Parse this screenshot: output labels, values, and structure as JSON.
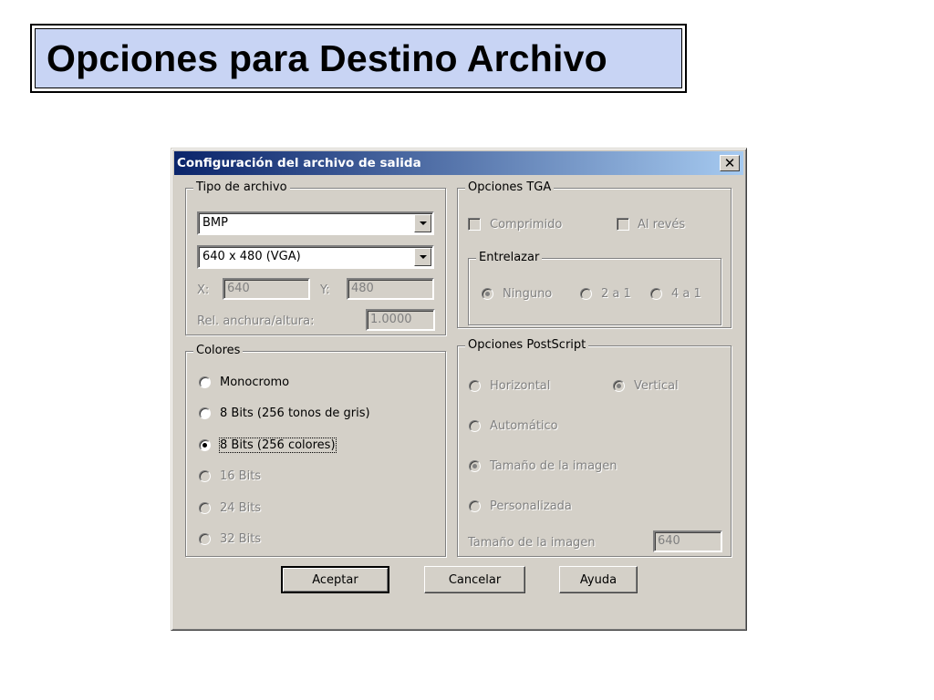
{
  "slide": {
    "title": "Opciones para Destino Archivo"
  },
  "dialog": {
    "title": "Configuración del archivo de salida",
    "close_label": "✕",
    "file_type": {
      "legend": "Tipo de archivo",
      "format_value": "BMP",
      "resolution_value": "640 x 480 (VGA)",
      "x_label": "X:",
      "x_value": "640",
      "y_label": "Y:",
      "y_value": "480",
      "ratio_label": "Rel. anchura/altura:",
      "ratio_value": "1.0000"
    },
    "colors": {
      "legend": "Colores",
      "options": [
        {
          "label": "Monocromo",
          "selected": false,
          "enabled": true
        },
        {
          "label": "8 Bits (256 tonos de gris)",
          "selected": false,
          "enabled": true
        },
        {
          "label": "8 Bits (256 colores)",
          "selected": true,
          "enabled": true
        },
        {
          "label": "16 Bits",
          "selected": false,
          "enabled": false
        },
        {
          "label": "24 Bits",
          "selected": false,
          "enabled": false
        },
        {
          "label": "32 Bits",
          "selected": false,
          "enabled": false
        }
      ]
    },
    "tga": {
      "legend": "Opciones TGA",
      "compressed_label": "Comprimido",
      "reversed_label": "Al revés",
      "interlace": {
        "legend": "Entrelazar",
        "none_label": "Ninguno",
        "two_label": "2 a 1",
        "four_label": "4 a 1",
        "selected": "Ninguno"
      }
    },
    "postscript": {
      "legend": "Opciones PostScript",
      "horizontal_label": "Horizontal",
      "vertical_label": "Vertical",
      "auto_label": "Automático",
      "image_size_option_label": "Tamaño de la imagen",
      "custom_label": "Personalizada",
      "image_size_label": "Tamaño de la imagen",
      "image_size_value": "640"
    },
    "buttons": {
      "accept": "Aceptar",
      "cancel": "Cancelar",
      "help": "Ayuda"
    }
  }
}
